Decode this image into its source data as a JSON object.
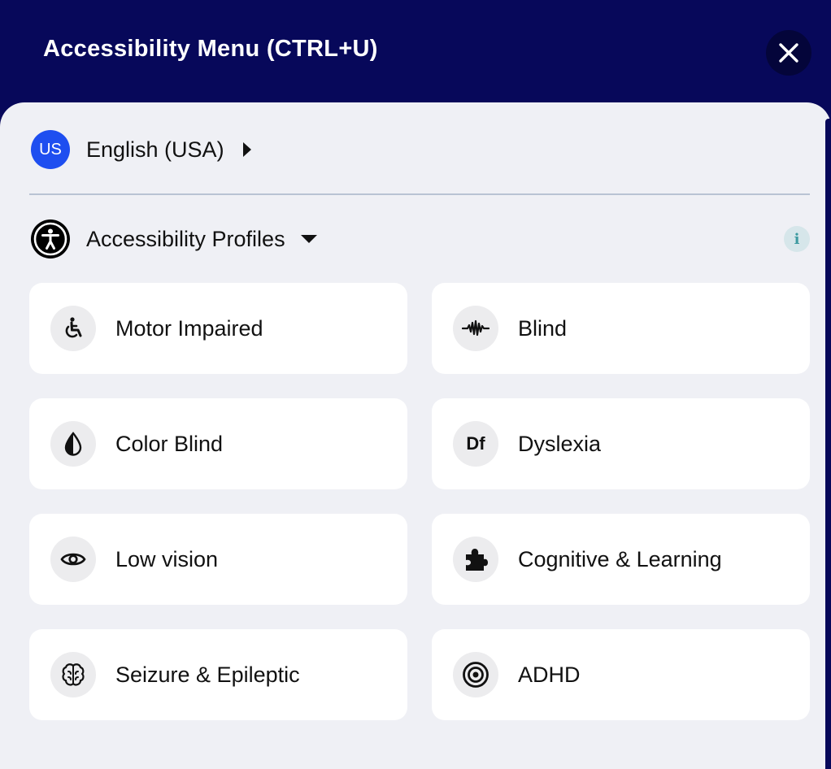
{
  "header": {
    "title": "Accessibility Menu (CTRL+U)",
    "close_icon": "close-icon"
  },
  "language": {
    "badge": "US",
    "label": "English (USA)",
    "arrow_icon": "caret-right-icon"
  },
  "profiles": {
    "label": "Accessibility Profiles",
    "icon": "accessibility-person-icon",
    "caret_icon": "caret-down-icon",
    "info": "i"
  },
  "cards": [
    {
      "label": "Motor Impaired",
      "icon": "wheelchair-icon"
    },
    {
      "label": "Blind",
      "icon": "soundwave-icon"
    },
    {
      "label": "Color Blind",
      "icon": "drop-icon"
    },
    {
      "label": "Dyslexia",
      "icon": "df-icon",
      "icon_text": "Df"
    },
    {
      "label": "Low vision",
      "icon": "eye-icon"
    },
    {
      "label": "Cognitive & Learning",
      "icon": "puzzle-icon"
    },
    {
      "label": "Seizure & Epileptic",
      "icon": "brain-icon"
    },
    {
      "label": "ADHD",
      "icon": "target-icon"
    }
  ],
  "colors": {
    "header": "#07085a",
    "panel": "#eff0f5",
    "card": "#ffffff",
    "badge": "#1e4ef0"
  }
}
